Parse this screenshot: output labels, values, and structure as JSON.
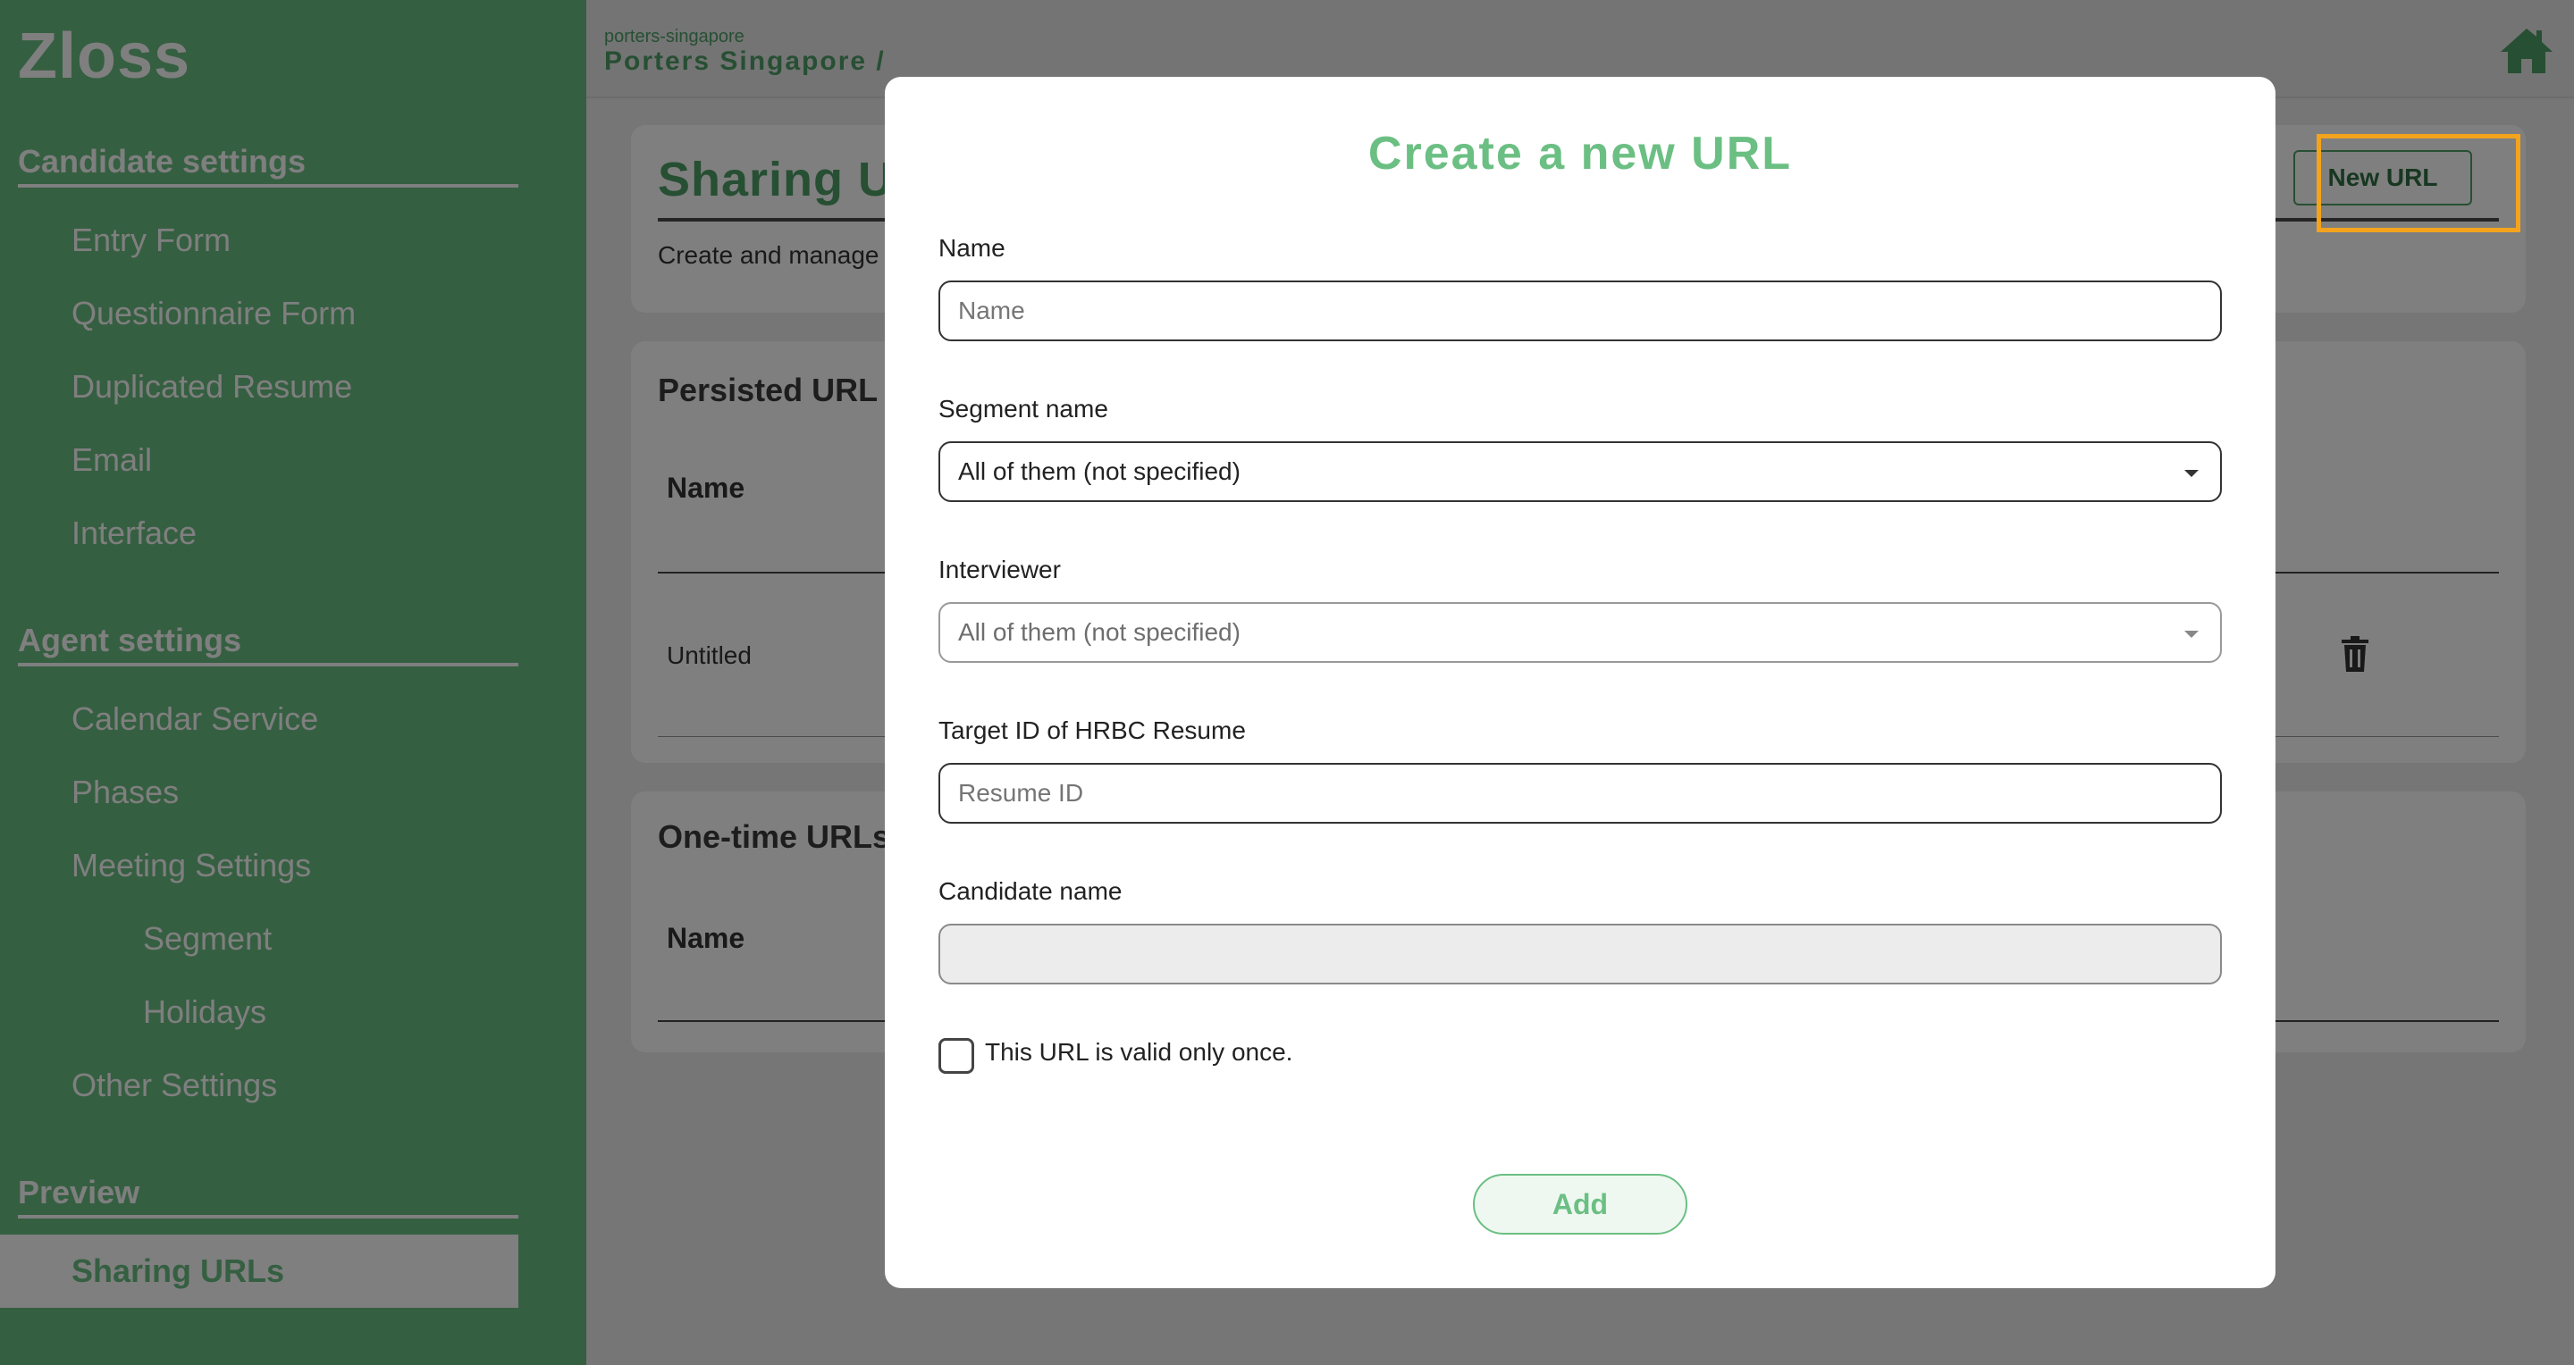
{
  "sidebar": {
    "logo": "Zloss",
    "sections": {
      "candidate": {
        "title": "Candidate settings",
        "items": [
          "Entry Form",
          "Questionnaire Form",
          "Duplicated Resume",
          "Email",
          "Interface"
        ]
      },
      "agent": {
        "title": "Agent settings",
        "items": [
          "Calendar Service",
          "Phases",
          "Meeting Settings"
        ],
        "sub_items": [
          "Segment",
          "Holidays"
        ],
        "after_items": [
          "Other Settings"
        ]
      },
      "preview": {
        "title": "Preview",
        "active_item": "Sharing URLs"
      }
    }
  },
  "header": {
    "org_id": "porters-singapore",
    "org_name": "Porters Singapore /",
    "home_icon": "home-icon"
  },
  "page": {
    "title": "Sharing URLs",
    "subtitle": "Create and manage",
    "new_url_label": "New URL",
    "persisted": {
      "title": "Persisted URL",
      "column_name": "Name",
      "rows": [
        {
          "name": "Untitled"
        }
      ]
    },
    "one_time": {
      "title": "One-time URLs",
      "column_name": "Name"
    }
  },
  "modal": {
    "title": "Create a new URL",
    "name": {
      "label": "Name",
      "placeholder": "Name",
      "value": ""
    },
    "segment": {
      "label": "Segment name",
      "value": "All of them (not specified)"
    },
    "interviewer": {
      "label": "Interviewer",
      "value": "All of them (not specified)"
    },
    "target_id": {
      "label": "Target ID of HRBC Resume",
      "placeholder": "Resume ID",
      "value": ""
    },
    "candidate_name": {
      "label": "Candidate name",
      "value": ""
    },
    "once_checkbox": {
      "label": "This URL is valid only once.",
      "checked": false
    },
    "add_label": "Add"
  },
  "colors": {
    "brand_green": "#6bbf83",
    "dark_green": "#4e9e66",
    "highlight": "#f3a31d"
  }
}
